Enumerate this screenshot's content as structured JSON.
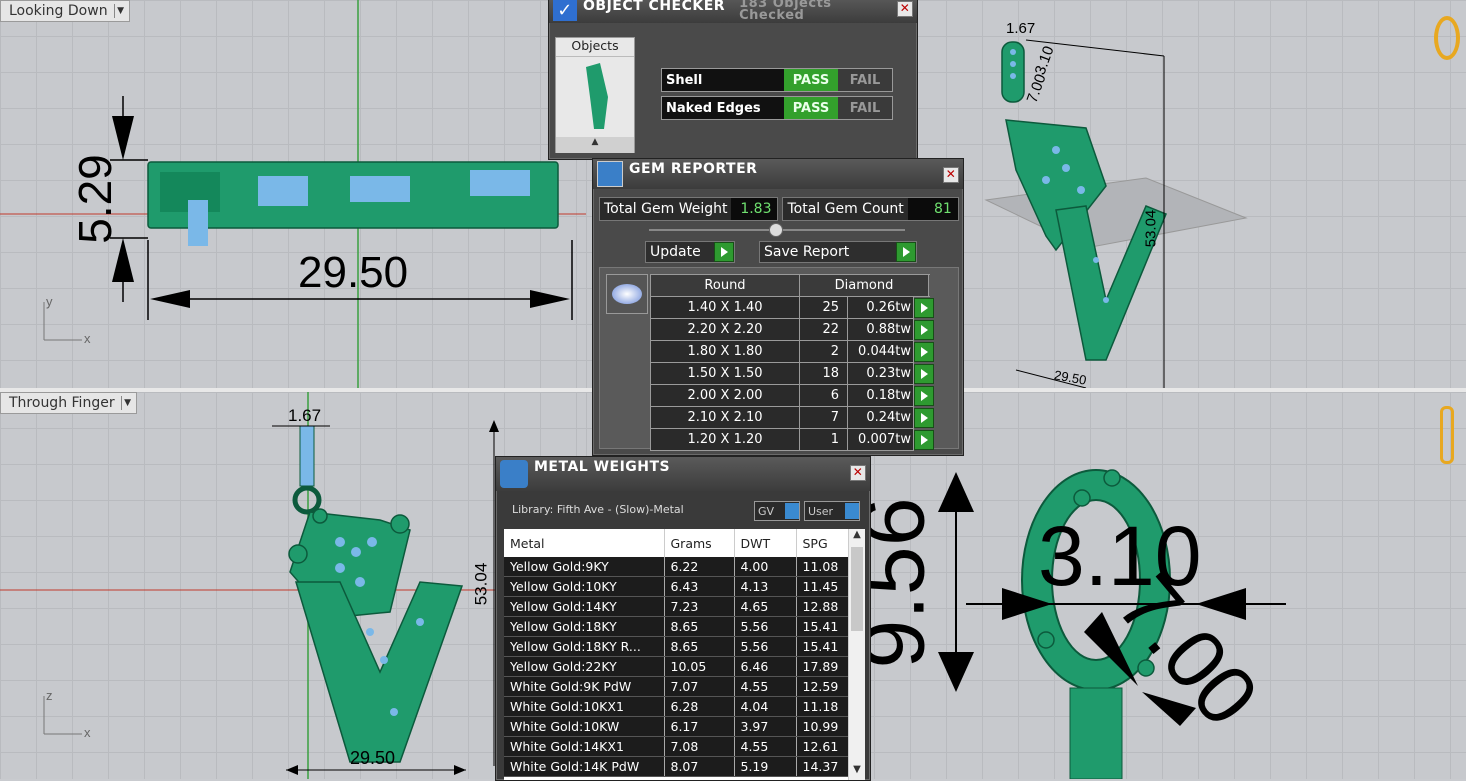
{
  "viewports": {
    "top_left": {
      "label": "Looking Down",
      "dims": [
        "5.29",
        "29.50"
      ],
      "axes": [
        "y",
        "x"
      ]
    },
    "top_right": {
      "dims": [
        "1.67",
        "3.10",
        "7.00",
        "53.04",
        "29.50"
      ]
    },
    "bottom_left": {
      "label": "Through Finger",
      "dims": [
        "1.67",
        "53.04",
        "29.50"
      ],
      "axes": [
        "z",
        "x"
      ]
    },
    "bottom_right": {
      "dims": [
        "9.56",
        "3.10",
        "7.00"
      ]
    }
  },
  "object_checker": {
    "title": "OBJECT CHECKER",
    "summary_line1": "183  Objects",
    "summary_line2": "Checked",
    "objects_tab": "Objects",
    "rows": [
      {
        "label": "Shell",
        "pass": "PASS",
        "fail": "FAIL"
      },
      {
        "label": "Naked Edges",
        "pass": "PASS",
        "fail": "FAIL"
      }
    ]
  },
  "gem_reporter": {
    "title": "GEM REPORTER",
    "total_weight_label": "Total Gem Weight",
    "total_weight": "1.83",
    "total_count_label": "Total Gem Count",
    "total_count": "81",
    "update_label": "Update",
    "save_label": "Save Report",
    "col_shape": "Round",
    "col_material": "Diamond",
    "rows": [
      {
        "size": "1.40 X 1.40",
        "qty": "25",
        "weight": "0.26tw"
      },
      {
        "size": "2.20 X 2.20",
        "qty": "22",
        "weight": "0.88tw"
      },
      {
        "size": "1.80 X 1.80",
        "qty": "2",
        "weight": "0.044tw"
      },
      {
        "size": "1.50 X 1.50",
        "qty": "18",
        "weight": "0.23tw"
      },
      {
        "size": "2.00 X 2.00",
        "qty": "6",
        "weight": "0.18tw"
      },
      {
        "size": "2.10 X 2.10",
        "qty": "7",
        "weight": "0.24tw"
      },
      {
        "size": "1.20 X 1.20",
        "qty": "1",
        "weight": "0.007tw"
      }
    ]
  },
  "metal_weights": {
    "title": "METAL WEIGHTS",
    "library": "Library: Fifth Ave - (Slow)-Metal",
    "gv_label": "GV",
    "user_label": "User",
    "headers": [
      "Metal",
      "Grams",
      "DWT",
      "SPG"
    ],
    "rows": [
      [
        "Yellow Gold:9KY",
        "6.22",
        "4.00",
        "11.08"
      ],
      [
        "Yellow Gold:10KY",
        "6.43",
        "4.13",
        "11.45"
      ],
      [
        "Yellow Gold:14KY",
        "7.23",
        "4.65",
        "12.88"
      ],
      [
        "Yellow Gold:18KY",
        "8.65",
        "5.56",
        "15.41"
      ],
      [
        "Yellow Gold:18KY R...",
        "8.65",
        "5.56",
        "15.41"
      ],
      [
        "Yellow Gold:22KY",
        "10.05",
        "6.46",
        "17.89"
      ],
      [
        "White Gold:9K PdW",
        "7.07",
        "4.55",
        "12.59"
      ],
      [
        "White Gold:10KX1",
        "6.28",
        "4.04",
        "11.18"
      ],
      [
        "White Gold:10KW",
        "6.17",
        "3.97",
        "10.99"
      ],
      [
        "White Gold:14KX1",
        "7.08",
        "4.55",
        "12.61"
      ],
      [
        "White Gold:14K PdW",
        "8.07",
        "5.19",
        "14.37"
      ]
    ]
  },
  "colors": {
    "metal": "#1f9b6c",
    "stone": "#7ab8e8",
    "panel": "#4a4a4a",
    "pass": "#33a02c"
  }
}
